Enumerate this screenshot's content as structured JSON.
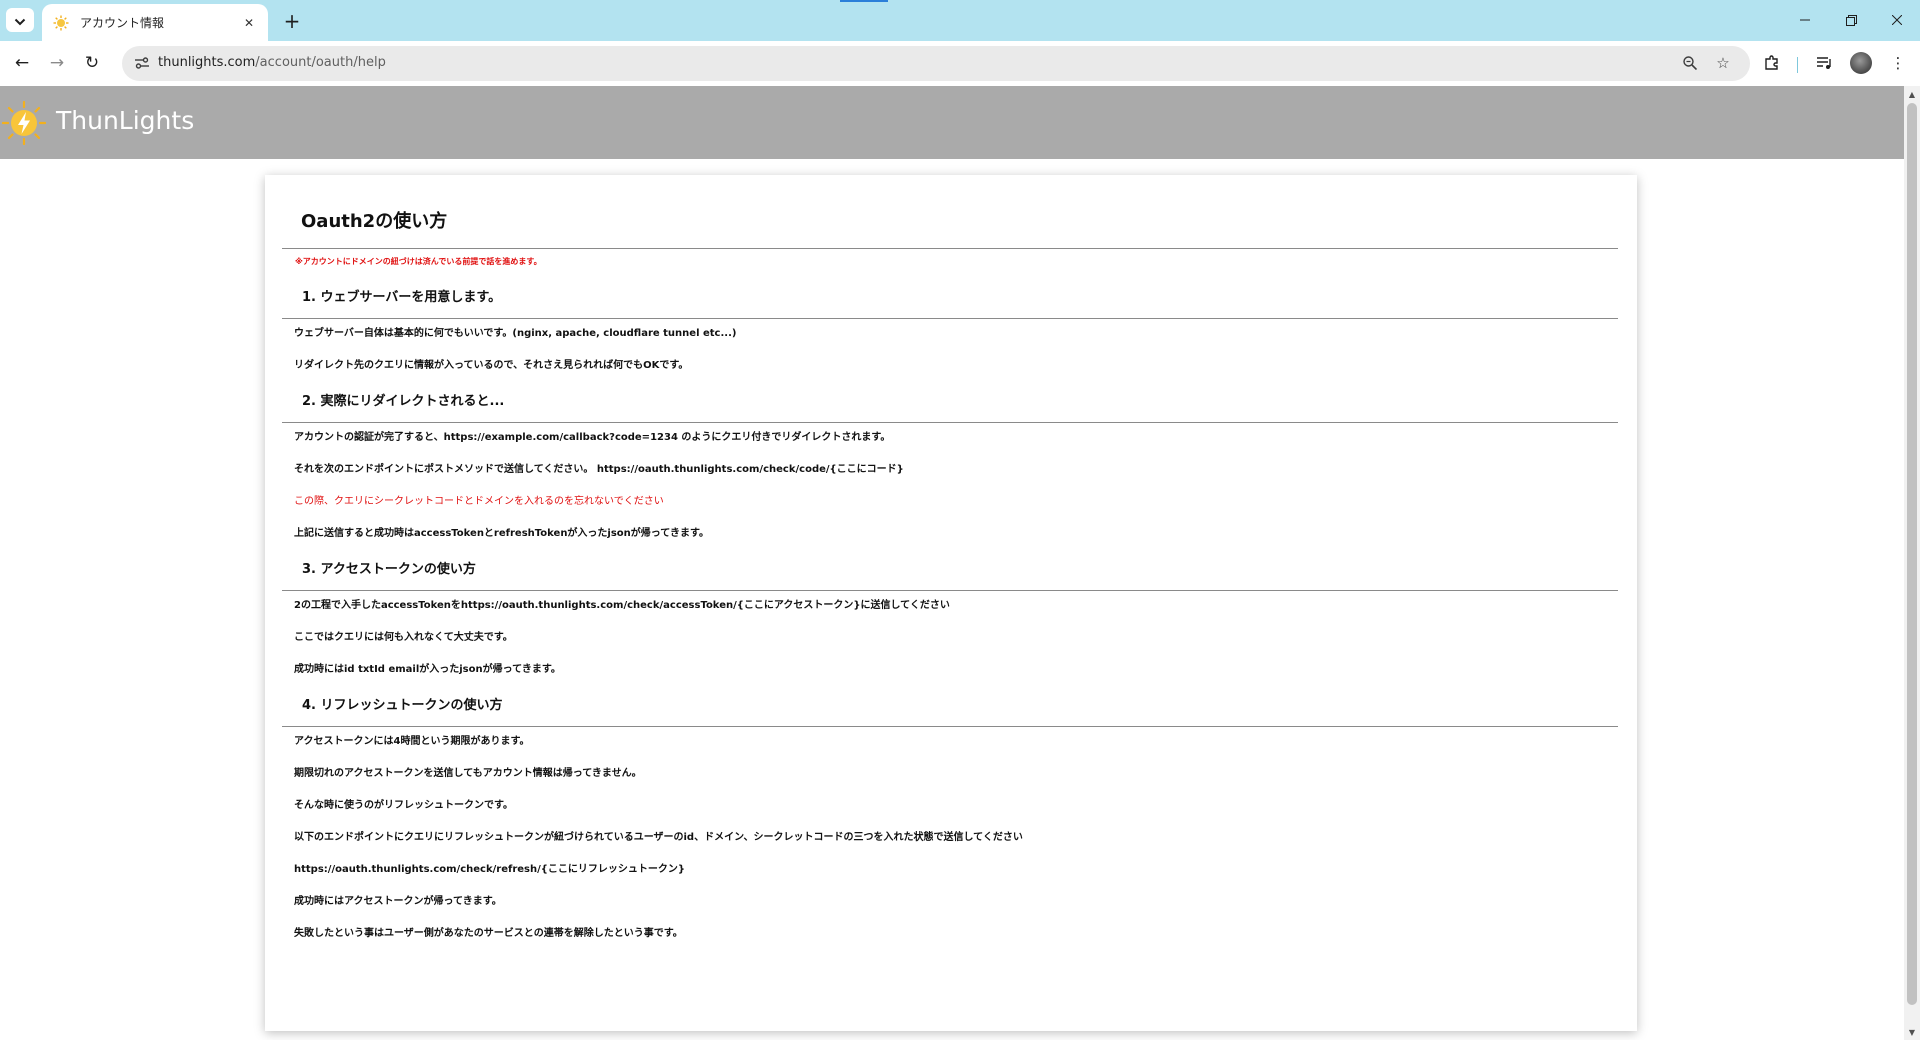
{
  "browser": {
    "tab": {
      "title": "アカウント情報"
    },
    "address": {
      "host": "thunlights.com",
      "path": "/account/oauth/help"
    }
  },
  "site": {
    "name": "ThunLights"
  },
  "doc": {
    "title": "Oauth2の使い方",
    "note": "※アカウントにドメインの紐づけは済んでいる前提で話を進めます。",
    "sections": [
      {
        "heading": "1. ウェブサーバーを用意します。",
        "paragraphs": [
          "ウェブサーバー自体は基本的に何でもいいです。(nginx, apache, cloudflare tunnel etc...)",
          "リダイレクト先のクエリに情報が入っているので、それさえ見られれば何でもOKです。"
        ]
      },
      {
        "heading": "2. 実際にリダイレクトされると...",
        "paragraphs": [
          "アカウントの認証が完了すると、https://example.com/callback?code=1234 のようにクエリ付きでリダイレクトされます。",
          "それを次のエンドポイントにポストメソッドで送信してください。 https://oauth.thunlights.com/check/code/{ここにコード}",
          "この際、クエリにシークレットコードとドメインを入れるのを忘れないでください",
          "上記に送信すると成功時はaccessTokenとrefreshTokenが入ったjsonが帰ってきます。"
        ]
      },
      {
        "heading": "3. アクセストークンの使い方",
        "paragraphs": [
          "2の工程で入手したaccessTokenをhttps://oauth.thunlights.com/check/accessToken/{ここにアクセストークン}に送信してください",
          "ここではクエリには何も入れなくて大丈夫です。",
          "成功時にはid txtId emailが入ったjsonが帰ってきます。"
        ]
      },
      {
        "heading": "4. リフレッシュトークンの使い方",
        "paragraphs": [
          "アクセストークンには4時間という期限があります。",
          "期限切れのアクセストークンを送信してもアカウント情報は帰ってきません。",
          "そんな時に使うのがリフレッシュトークンです。",
          "以下のエンドポイントにクエリにリフレッシュトークンが紐づけられているユーザーのid、ドメイン、シークレットコードの三つを入れた状態で送信してください",
          "https://oauth.thunlights.com/check/refresh/{ここにリフレッシュトークン}",
          "成功時にはアクセストークンが帰ってきます。",
          "失敗したという事はユーザー側があなたのサービスとの連帯を解除したという事です。"
        ]
      }
    ]
  },
  "colors": {
    "tabstrip": "#b3e3f0",
    "header": "#aaaaaa",
    "warning": "#e01010"
  },
  "icons": [
    "tab-list-icon",
    "sun-favicon-icon",
    "close-icon",
    "plus-icon",
    "minimize-icon",
    "restore-icon",
    "window-close-icon",
    "back-icon",
    "forward-icon",
    "reload-icon",
    "site-info-icon",
    "zoom-icon",
    "star-icon",
    "extensions-icon",
    "media-icon",
    "avatar",
    "menu-icon",
    "thunlights-logo"
  ]
}
